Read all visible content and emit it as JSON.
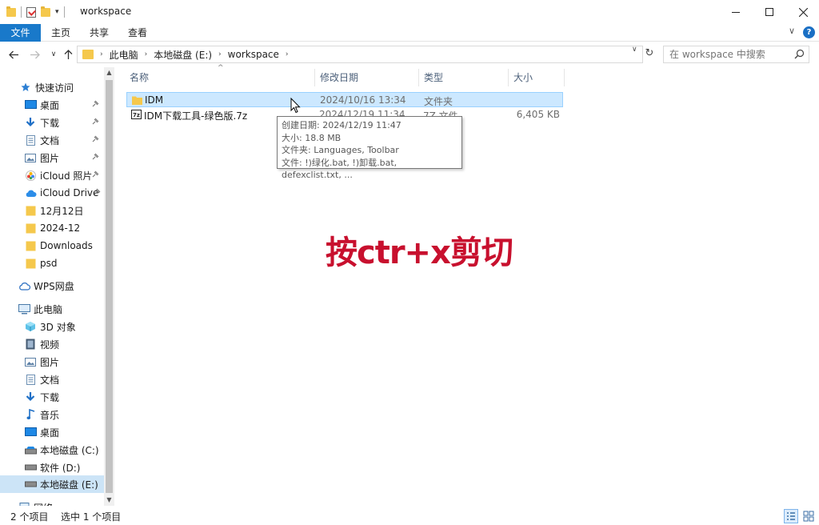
{
  "window": {
    "title": "workspace"
  },
  "ribbon": {
    "file": "文件",
    "home": "主页",
    "share": "共享",
    "view": "查看"
  },
  "address": {
    "crumbs": [
      "此电脑",
      "本地磁盘 (E:)",
      "workspace"
    ]
  },
  "search": {
    "placeholder": "在 workspace 中搜索"
  },
  "sidebar": {
    "quick_access": "快速访问",
    "quick_items": [
      {
        "label": "桌面",
        "pinned": true
      },
      {
        "label": "下载",
        "pinned": true
      },
      {
        "label": "文档",
        "pinned": true
      },
      {
        "label": "图片",
        "pinned": true
      },
      {
        "label": "iCloud 照片",
        "pinned": true
      },
      {
        "label": "iCloud Drive",
        "pinned": true
      },
      {
        "label": "12月12日"
      },
      {
        "label": "2024-12"
      },
      {
        "label": "Downloads"
      },
      {
        "label": "psd"
      }
    ],
    "wps": "WPS网盘",
    "this_pc": "此电脑",
    "pc_items": [
      {
        "label": "3D 对象"
      },
      {
        "label": "视频"
      },
      {
        "label": "图片"
      },
      {
        "label": "文档"
      },
      {
        "label": "下载"
      },
      {
        "label": "音乐"
      },
      {
        "label": "桌面"
      },
      {
        "label": "本地磁盘 (C:)"
      },
      {
        "label": "软件 (D:)"
      },
      {
        "label": "本地磁盘 (E:)",
        "selected": true
      }
    ],
    "network": "网络"
  },
  "columns": {
    "name": "名称",
    "date": "修改日期",
    "type": "类型",
    "size": "大小"
  },
  "files": [
    {
      "name": "IDM",
      "date": "2024/10/16 13:34",
      "type": "文件夹",
      "size": "",
      "selected": true
    },
    {
      "name": "IDM下载工具-绿色版.7z",
      "date": "2024/12/19 11:34",
      "type": "7Z 文件",
      "size": "6,405 KB"
    }
  ],
  "tooltip": {
    "created": "创建日期: 2024/12/19 11:47",
    "size": "大小: 18.8 MB",
    "folders": "文件夹: Languages, Toolbar",
    "files": "文件: !)绿化.bat, !)卸载.bat, defexclist.txt, ..."
  },
  "annotation": "按ctr+x剪切",
  "status": {
    "count": "2 个项目",
    "selected": "选中 1 个项目"
  },
  "colors": {
    "accent": "#1979ca",
    "selection": "#cce8ff",
    "annotation": "#c8102e"
  }
}
